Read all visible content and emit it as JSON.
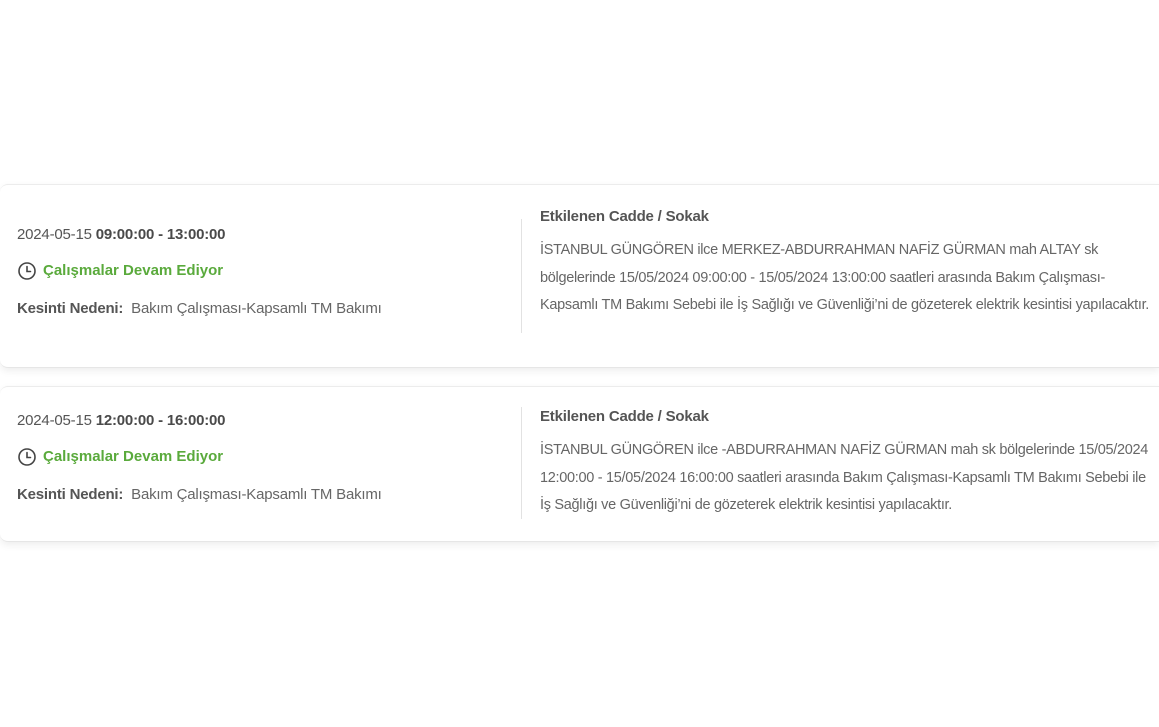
{
  "outages": [
    {
      "date": "2024-05-15",
      "time_range": "09:00:00 - 13:00:00",
      "status": "Çalışmalar Devam Ediyor",
      "reason_label": "Kesinti Nedeni:",
      "reason": "Bakım Çalışması-Kapsamlı TM Bakımı",
      "affected_title": "Etkilenen Cadde / Sokak",
      "affected_text": "İSTANBUL GÜNGÖREN ilce MERKEZ-ABDURRAHMAN NAFİZ GÜRMAN mah ALTAY sk bölgelerinde 15/05/2024 09:00:00 - 15/05/2024 13:00:00 saatleri arasında Bakım Çalışması-Kapsamlı TM Bakımı Sebebi ile İş Sağlığı ve Güvenliği’ni de gözeterek elektrik kesintisi yapılacaktır."
    },
    {
      "date": "2024-05-15",
      "time_range": "12:00:00 - 16:00:00",
      "status": "Çalışmalar Devam Ediyor",
      "reason_label": "Kesinti Nedeni:",
      "reason": "Bakım Çalışması-Kapsamlı TM Bakımı",
      "affected_title": "Etkilenen Cadde / Sokak",
      "affected_text": "İSTANBUL GÜNGÖREN ilce -ABDURRAHMAN NAFİZ GÜRMAN mah sk bölgelerinde 15/05/2024 12:00:00 - 15/05/2024 16:00:00 saatleri arasında Bakım Çalışması-Kapsamlı TM Bakımı Sebebi ile İş Sağlığı ve Güvenliği’ni de gözeterek elektrik kesintisi yapılacaktır."
    }
  ],
  "icons": {
    "status": "clock-icon"
  },
  "colors": {
    "status_green": "#5aaa3c",
    "text_gray": "#666666"
  }
}
